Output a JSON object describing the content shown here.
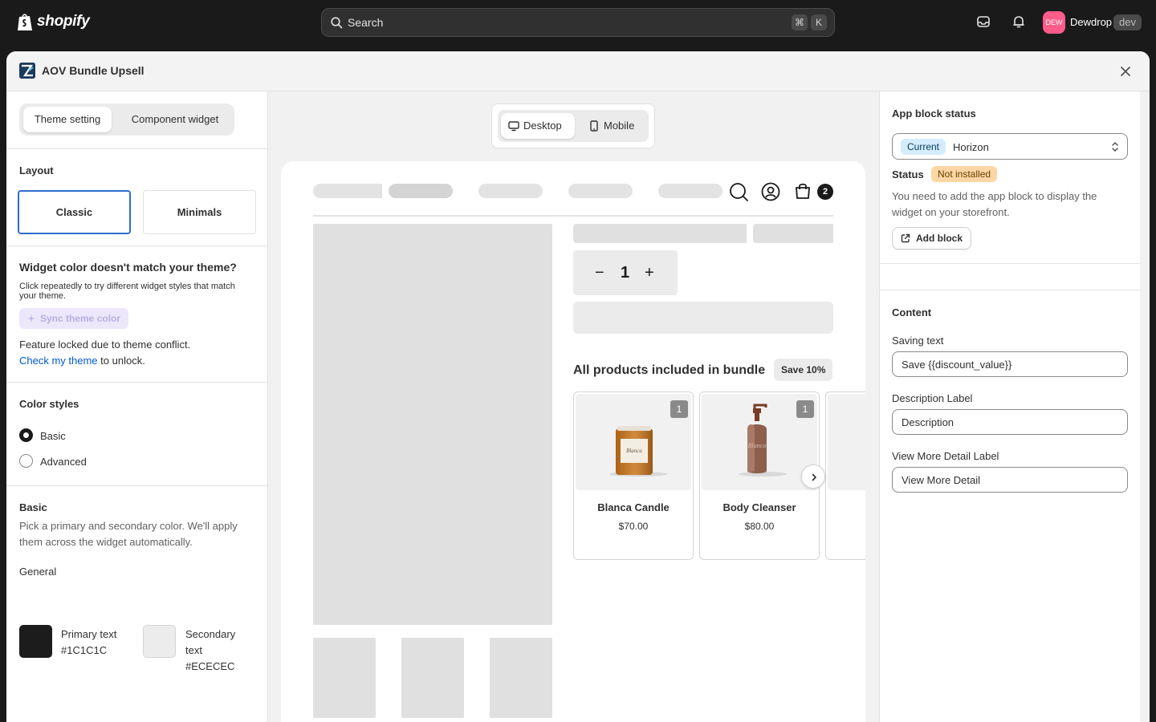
{
  "topbar": {
    "logo_text": "shopify",
    "search_placeholder": "Search",
    "shortcut_cmd": "⌘",
    "shortcut_key": "K",
    "avatar_initials": "DEW",
    "store_name": "Dewdrop",
    "env_badge": "dev"
  },
  "modal": {
    "title": "AOV Bundle Upsell"
  },
  "left": {
    "tabs": [
      "Theme setting",
      "Component widget"
    ],
    "layout_title": "Layout",
    "layouts": [
      "Classic",
      "Minimals"
    ],
    "mismatch_title": "Widget color doesn't match your theme?",
    "mismatch_desc": "Click repeatedly to try different widget styles that match your theme.",
    "sync_label": "Sync theme color",
    "locked_text": "Feature locked due to theme conflict.",
    "check_link": "Check my theme",
    "unlock_text": " to unlock.",
    "color_styles_title": "Color styles",
    "color_options": [
      "Basic",
      "Advanced"
    ],
    "basic_title": "Basic",
    "basic_desc": "Pick a primary and secondary color. We'll apply them across the widget automatically.",
    "general_label": "General",
    "primary_label": "Primary text",
    "primary_value": "#1C1C1C",
    "secondary_label": "Secondary text",
    "secondary_value": "#ECECEC"
  },
  "preview": {
    "device_tabs": [
      "Desktop",
      "Mobile"
    ],
    "cart_count": "2",
    "quantity": "1",
    "qty_minus": "−",
    "qty_plus": "+",
    "bundle_title": "All products included in bundle",
    "save_badge": "Save 10%",
    "products": [
      {
        "name": "Blanca Candle",
        "price": "$70.00",
        "qty": "1"
      },
      {
        "name": "Body Cleanser",
        "price": "$80.00",
        "qty": "1"
      }
    ]
  },
  "right": {
    "app_block_title": "App block status",
    "theme_current_badge": "Current",
    "theme_name": "Horizon",
    "status_label": "Status",
    "status_value": "Not installed",
    "status_desc": "You need to add the app block to display the widget on your storefront.",
    "add_block_label": "Add block",
    "content_title": "Content",
    "saving_text_label": "Saving text",
    "saving_text_value": "Save {{discount_value}}",
    "description_label_label": "Description Label",
    "description_label_value": "Description",
    "view_more_label": "View More Detail Label",
    "view_more_value": "View More Detail"
  },
  "colors": {
    "accent": "#2c6ecb",
    "primary_swatch": "#1C1C1C",
    "secondary_swatch": "#ECECEC",
    "avatar": "#ff5c8a"
  }
}
